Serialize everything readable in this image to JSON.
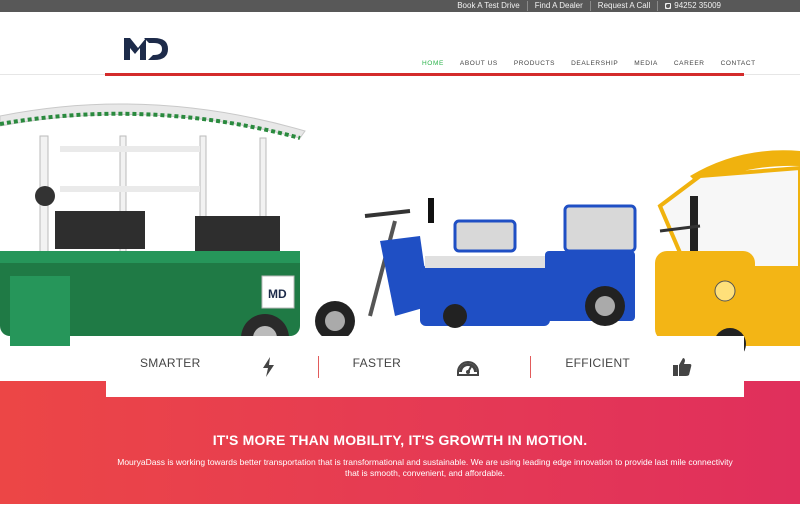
{
  "topbar": {
    "links": [
      "Book A Test Drive",
      "Find A Dealer",
      "Request A Call"
    ],
    "phone": "94252 35009"
  },
  "brand": {
    "logo_text": "MD",
    "logo_color": "#1d2b4a"
  },
  "nav": {
    "items": [
      "HOME",
      "ABOUT US",
      "PRODUCTS",
      "DEALERSHIP",
      "MEDIA",
      "CAREER",
      "CONTACT"
    ],
    "active": "HOME",
    "active_color": "#2bb34b"
  },
  "features": [
    {
      "label": "SMARTER",
      "icon": "lightning-icon"
    },
    {
      "label": "FASTER",
      "icon": "speedometer-icon"
    },
    {
      "label": "EFFICIENT",
      "icon": "thumbs-up-icon"
    }
  ],
  "banner": {
    "headline": "IT'S MORE THAN MOBILITY, IT'S GROWTH IN MOTION.",
    "body": "MouryaDass is working towards better transportation that is transformational and sustainable. We are using leading edge innovation to provide last mile connectivity that is smooth, convenient, and affordable."
  },
  "colors": {
    "accent_red": "#d42b2b",
    "banner_start": "#ec4646",
    "banner_end": "#e02f5c",
    "topbar": "#585858"
  }
}
